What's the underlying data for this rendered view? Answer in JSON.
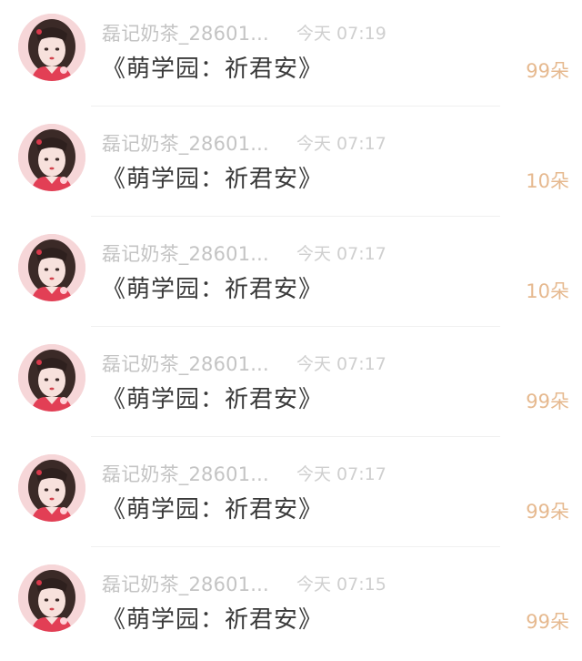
{
  "colors": {
    "name": "#c4c4c4",
    "time": "#cfcfcf",
    "title": "#3a3a3a",
    "amount": "#e6b98f",
    "divider": "#f0f0f0"
  },
  "items": [
    {
      "name": "磊记奶茶_28601...",
      "time": "今天 07:19",
      "title": "《萌学园：祈君安》",
      "amount": "99朵",
      "avatar_icon": "girl-portrait-avatar"
    },
    {
      "name": "磊记奶茶_28601...",
      "time": "今天 07:17",
      "title": "《萌学园：祈君安》",
      "amount": "10朵",
      "avatar_icon": "girl-portrait-avatar"
    },
    {
      "name": "磊记奶茶_28601...",
      "time": "今天 07:17",
      "title": "《萌学园：祈君安》",
      "amount": "10朵",
      "avatar_icon": "girl-portrait-avatar"
    },
    {
      "name": "磊记奶茶_28601...",
      "time": "今天 07:17",
      "title": "《萌学园：祈君安》",
      "amount": "99朵",
      "avatar_icon": "girl-portrait-avatar"
    },
    {
      "name": "磊记奶茶_28601...",
      "time": "今天 07:17",
      "title": "《萌学园：祈君安》",
      "amount": "99朵",
      "avatar_icon": "girl-portrait-avatar"
    },
    {
      "name": "磊记奶茶_28601...",
      "time": "今天 07:15",
      "title": "《萌学园：祈君安》",
      "amount": "99朵",
      "avatar_icon": "girl-portrait-avatar"
    }
  ]
}
